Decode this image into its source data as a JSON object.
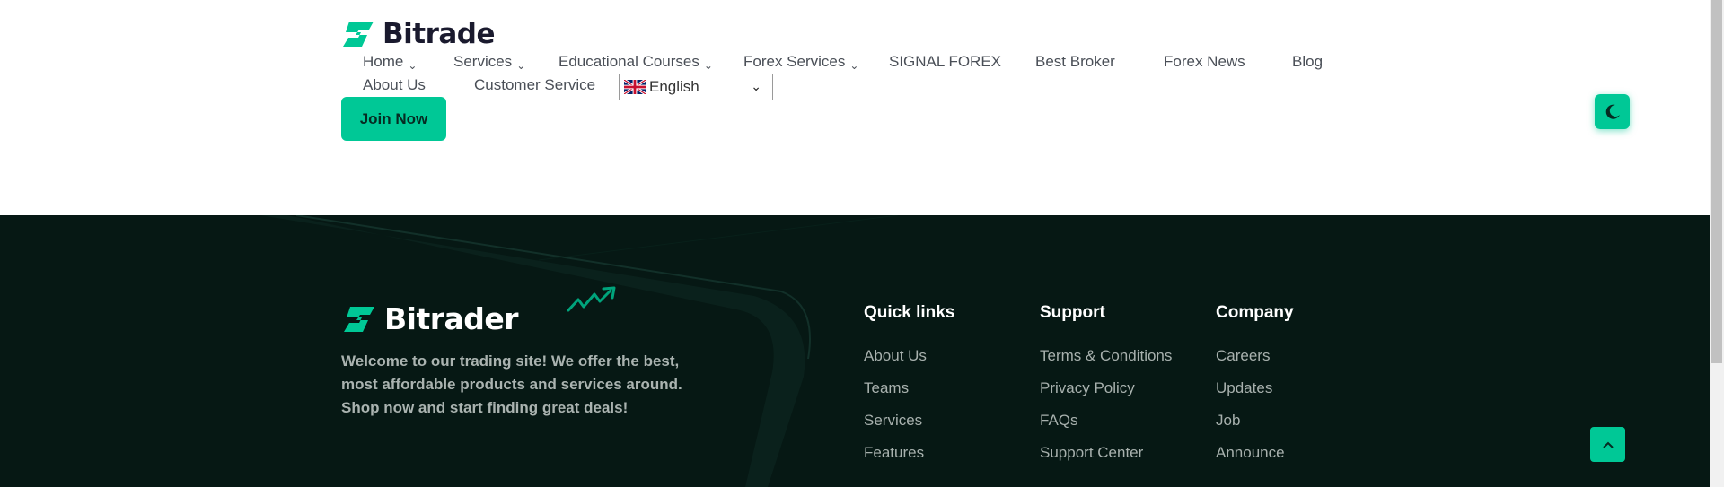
{
  "header": {
    "brand": "Bitrade",
    "nav": [
      {
        "label": "Home",
        "dropdown": true
      },
      {
        "label": "Services",
        "dropdown": true
      },
      {
        "label": "Educational Courses",
        "dropdown": true
      },
      {
        "label": "Forex Services",
        "dropdown": true
      },
      {
        "label": "SIGNAL FOREX",
        "dropdown": false
      },
      {
        "label": "Best Broker",
        "dropdown": false
      },
      {
        "label": "Forex News",
        "dropdown": false
      },
      {
        "label": "Blog",
        "dropdown": false
      },
      {
        "label": "About Us",
        "dropdown": false
      },
      {
        "label": "Customer Service",
        "dropdown": false
      }
    ],
    "language": "English",
    "join_label": "Join Now",
    "theme_toggle_icon": "moon-icon"
  },
  "footer": {
    "brand": "Bitrader",
    "description": "Welcome to our trading site! We offer the best, most affordable products and services around. Shop now and start finding great deals!",
    "columns": [
      {
        "title": "Quick links",
        "links": [
          "About Us",
          "Teams",
          "Services",
          "Features"
        ]
      },
      {
        "title": "Support",
        "links": [
          "Terms & Conditions",
          "Privacy Policy",
          "FAQs",
          "Support Center"
        ]
      },
      {
        "title": "Company",
        "links": [
          "Careers",
          "Updates",
          "Job",
          "Announce"
        ]
      }
    ],
    "back_to_top_icon": "chevron-up-icon"
  },
  "colors": {
    "accent": "#00c896",
    "footer_bg": "#061814",
    "nav_text": "#4a4f57",
    "brand_dark": "#1a1a2e"
  }
}
